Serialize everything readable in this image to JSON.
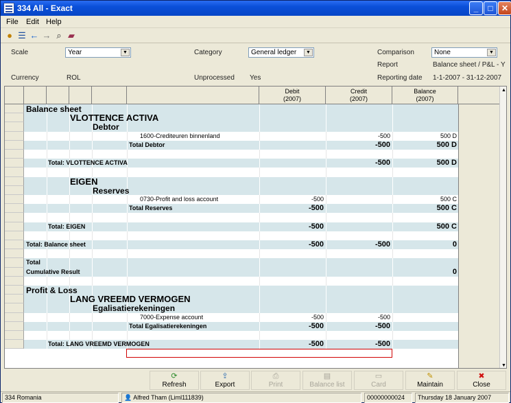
{
  "window": {
    "title": "334 All - Exact"
  },
  "menu": {
    "file": "File",
    "edit": "Edit",
    "help": "Help"
  },
  "params": {
    "scale_label": "Scale",
    "scale_value": "Year",
    "category_label": "Category",
    "category_value": "General ledger",
    "comparison_label": "Comparison",
    "comparison_value": "None",
    "report_label": "Report",
    "report_value": "Balance sheet / P&L - Y",
    "currency_label": "Currency",
    "currency_value": "ROL",
    "unprocessed_label": "Unprocessed",
    "unprocessed_value": "Yes",
    "reporting_date_label": "Reporting date",
    "reporting_date_value": "1-1-2007 - 31-12-2007"
  },
  "columns": {
    "debit": "Debit",
    "debit_sub": "(2007)",
    "credit": "Credit",
    "credit_sub": "(2007)",
    "balance": "Balance",
    "balance_sub": "(2007)"
  },
  "rows": [
    {
      "level": "h1",
      "label": "Balance sheet",
      "style": "c"
    },
    {
      "level": "h2",
      "label": "VLOTTENCE ACTIVA",
      "style": "c"
    },
    {
      "level": "h3",
      "label": "Debtor",
      "style": "c"
    },
    {
      "level": "acct",
      "label": "1600-Crediteuren binnenland",
      "debit": "",
      "credit": "-500",
      "balance": "500 D",
      "style": "w"
    },
    {
      "level": "tot",
      "label": "Total Debtor",
      "debit": "",
      "credit": "-500",
      "balance": "500 D",
      "style": "c"
    },
    {
      "level": "blank",
      "style": "w"
    },
    {
      "level": "tot2",
      "label": "Total: VLOTTENCE ACTIVA",
      "debit": "",
      "credit": "-500",
      "balance": "500 D",
      "style": "c"
    },
    {
      "level": "blank",
      "style": "w"
    },
    {
      "level": "h2",
      "label": "EIGEN",
      "style": "c"
    },
    {
      "level": "h3",
      "label": "Reserves",
      "style": "c"
    },
    {
      "level": "acct",
      "label": "0730-Profit and loss account",
      "debit": "-500",
      "credit": "",
      "balance": "500 C",
      "style": "w"
    },
    {
      "level": "tot",
      "label": "Total Reserves",
      "debit": "-500",
      "credit": "",
      "balance": "500 C",
      "style": "c"
    },
    {
      "level": "blank",
      "style": "w"
    },
    {
      "level": "tot2",
      "label": "Total: EIGEN",
      "debit": "-500",
      "credit": "",
      "balance": "500 C",
      "style": "c"
    },
    {
      "level": "blank",
      "style": "w"
    },
    {
      "level": "tot1",
      "label": "Total: Balance sheet",
      "debit": "-500",
      "credit": "-500",
      "balance": "0",
      "style": "c"
    },
    {
      "level": "blank",
      "style": "w"
    },
    {
      "level": "tot1",
      "label": "Total",
      "debit": "",
      "credit": "",
      "balance": "",
      "style": "c"
    },
    {
      "level": "tot1",
      "label": "Cumulative Result",
      "debit": "",
      "credit": "",
      "balance": "0",
      "style": "c"
    },
    {
      "level": "blank",
      "style": "w"
    },
    {
      "level": "h1",
      "label": "Profit & Loss",
      "style": "c"
    },
    {
      "level": "h2",
      "label": "LANG VREEMD VERMOGEN",
      "style": "c"
    },
    {
      "level": "h3",
      "label": "Egalisatierekeningen",
      "style": "c"
    },
    {
      "level": "acct",
      "label": "7000-Expense account",
      "debit": "-500",
      "credit": "-500",
      "balance": "",
      "style": "w"
    },
    {
      "level": "tot",
      "label": "Total Egalisatierekeningen",
      "debit": "-500",
      "credit": "-500",
      "balance": "",
      "style": "c"
    },
    {
      "level": "blank",
      "style": "w"
    },
    {
      "level": "tot2",
      "label": "Total: LANG VREEMD VERMOGEN",
      "debit": "-500",
      "credit": "-500",
      "balance": "",
      "style": "c"
    }
  ],
  "buttons": [
    {
      "label": "Refresh",
      "icon": "refresh-icon",
      "enabled": true
    },
    {
      "label": "Export",
      "icon": "export-icon",
      "enabled": true
    },
    {
      "label": "Print",
      "icon": "print-icon",
      "enabled": false
    },
    {
      "label": "Balance list",
      "icon": "balance-list-icon",
      "enabled": false
    },
    {
      "label": "Card",
      "icon": "card-icon",
      "enabled": false
    },
    {
      "label": "Maintain",
      "icon": "maintain-icon",
      "enabled": true
    },
    {
      "label": "Close",
      "icon": "close-icon",
      "enabled": true
    }
  ],
  "status": {
    "company": "334 Romania",
    "user": "Alfred Tham (Liml111839)",
    "number": "00000000024",
    "date": "Thursday 18 January 2007"
  },
  "colors": {
    "row": "#d6e6ea",
    "highlight": "#d00000",
    "titlebar": "#0a4fd8"
  }
}
